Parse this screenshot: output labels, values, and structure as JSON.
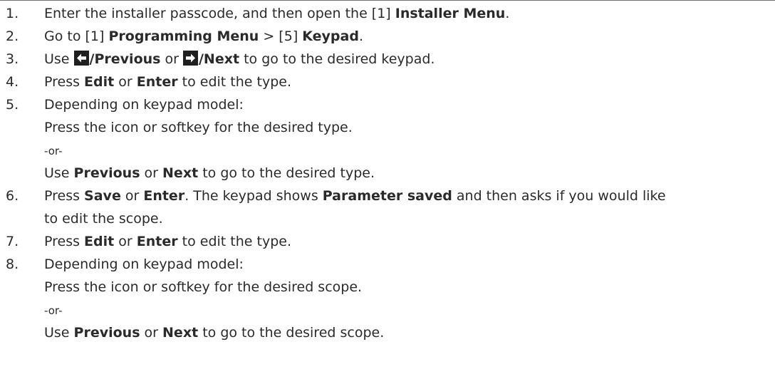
{
  "steps": [
    {
      "num": "1.",
      "lines": [
        [
          {
            "t": "Enter the installer passcode, and then open the [1] "
          },
          {
            "t": "Installer Menu",
            "b": true
          },
          {
            "t": "."
          }
        ]
      ]
    },
    {
      "num": "2.",
      "lines": [
        [
          {
            "t": "Go to [1] "
          },
          {
            "t": "Programming Menu",
            "b": true
          },
          {
            "t": " > [5] "
          },
          {
            "t": "Keypad",
            "b": true
          },
          {
            "t": "."
          }
        ]
      ]
    },
    {
      "num": "3.",
      "lines": [
        [
          {
            "t": "Use "
          },
          {
            "icon": "left-arrow-key-icon"
          },
          {
            "t": "/Previous",
            "b": true
          },
          {
            "t": " or "
          },
          {
            "icon": "right-arrow-key-icon"
          },
          {
            "t": "/Next",
            "b": true
          },
          {
            "t": " to go to the desired keypad."
          }
        ]
      ]
    },
    {
      "num": "4.",
      "lines": [
        [
          {
            "t": "Press "
          },
          {
            "t": "Edit",
            "b": true
          },
          {
            "t": " or "
          },
          {
            "t": "Enter",
            "b": true
          },
          {
            "t": " to edit the type."
          }
        ]
      ]
    },
    {
      "num": "5.",
      "lines": [
        [
          {
            "t": "Depending on keypad model:"
          }
        ],
        [
          {
            "t": "Press the icon or softkey for the desired type."
          }
        ],
        [
          {
            "t": "-or-",
            "small": true
          }
        ],
        [
          {
            "t": "Use "
          },
          {
            "t": "Previous",
            "b": true
          },
          {
            "t": " or "
          },
          {
            "t": "Next",
            "b": true
          },
          {
            "t": " to go to the desired type."
          }
        ]
      ]
    },
    {
      "num": "6.",
      "lines": [
        [
          {
            "t": "Press "
          },
          {
            "t": "Save",
            "b": true
          },
          {
            "t": " or "
          },
          {
            "t": "Enter",
            "b": true
          },
          {
            "t": ". The keypad shows "
          },
          {
            "t": "Parameter saved",
            "b": true
          },
          {
            "t": " and then asks if you would like"
          }
        ],
        [
          {
            "t": "to edit the scope."
          }
        ]
      ]
    },
    {
      "num": "7.",
      "lines": [
        [
          {
            "t": "Press "
          },
          {
            "t": "Edit",
            "b": true
          },
          {
            "t": " or "
          },
          {
            "t": "Enter",
            "b": true
          },
          {
            "t": " to edit the type."
          }
        ]
      ]
    },
    {
      "num": "8.",
      "lines": [
        [
          {
            "t": "Depending on keypad model:"
          }
        ],
        [
          {
            "t": "Press the icon or softkey for the desired scope."
          }
        ],
        [
          {
            "t": "-or-",
            "small": true
          }
        ],
        [
          {
            "t": "Use "
          },
          {
            "t": "Previous",
            "b": true
          },
          {
            "t": " or "
          },
          {
            "t": "Next",
            "b": true
          },
          {
            "t": " to go to the desired scope."
          }
        ]
      ]
    }
  ],
  "colors": {
    "text": "#2a2a2a",
    "rule": "#6e6e6e",
    "key_icon_bg": "#1f1f1f",
    "key_icon_arrow": "#ffffff"
  }
}
